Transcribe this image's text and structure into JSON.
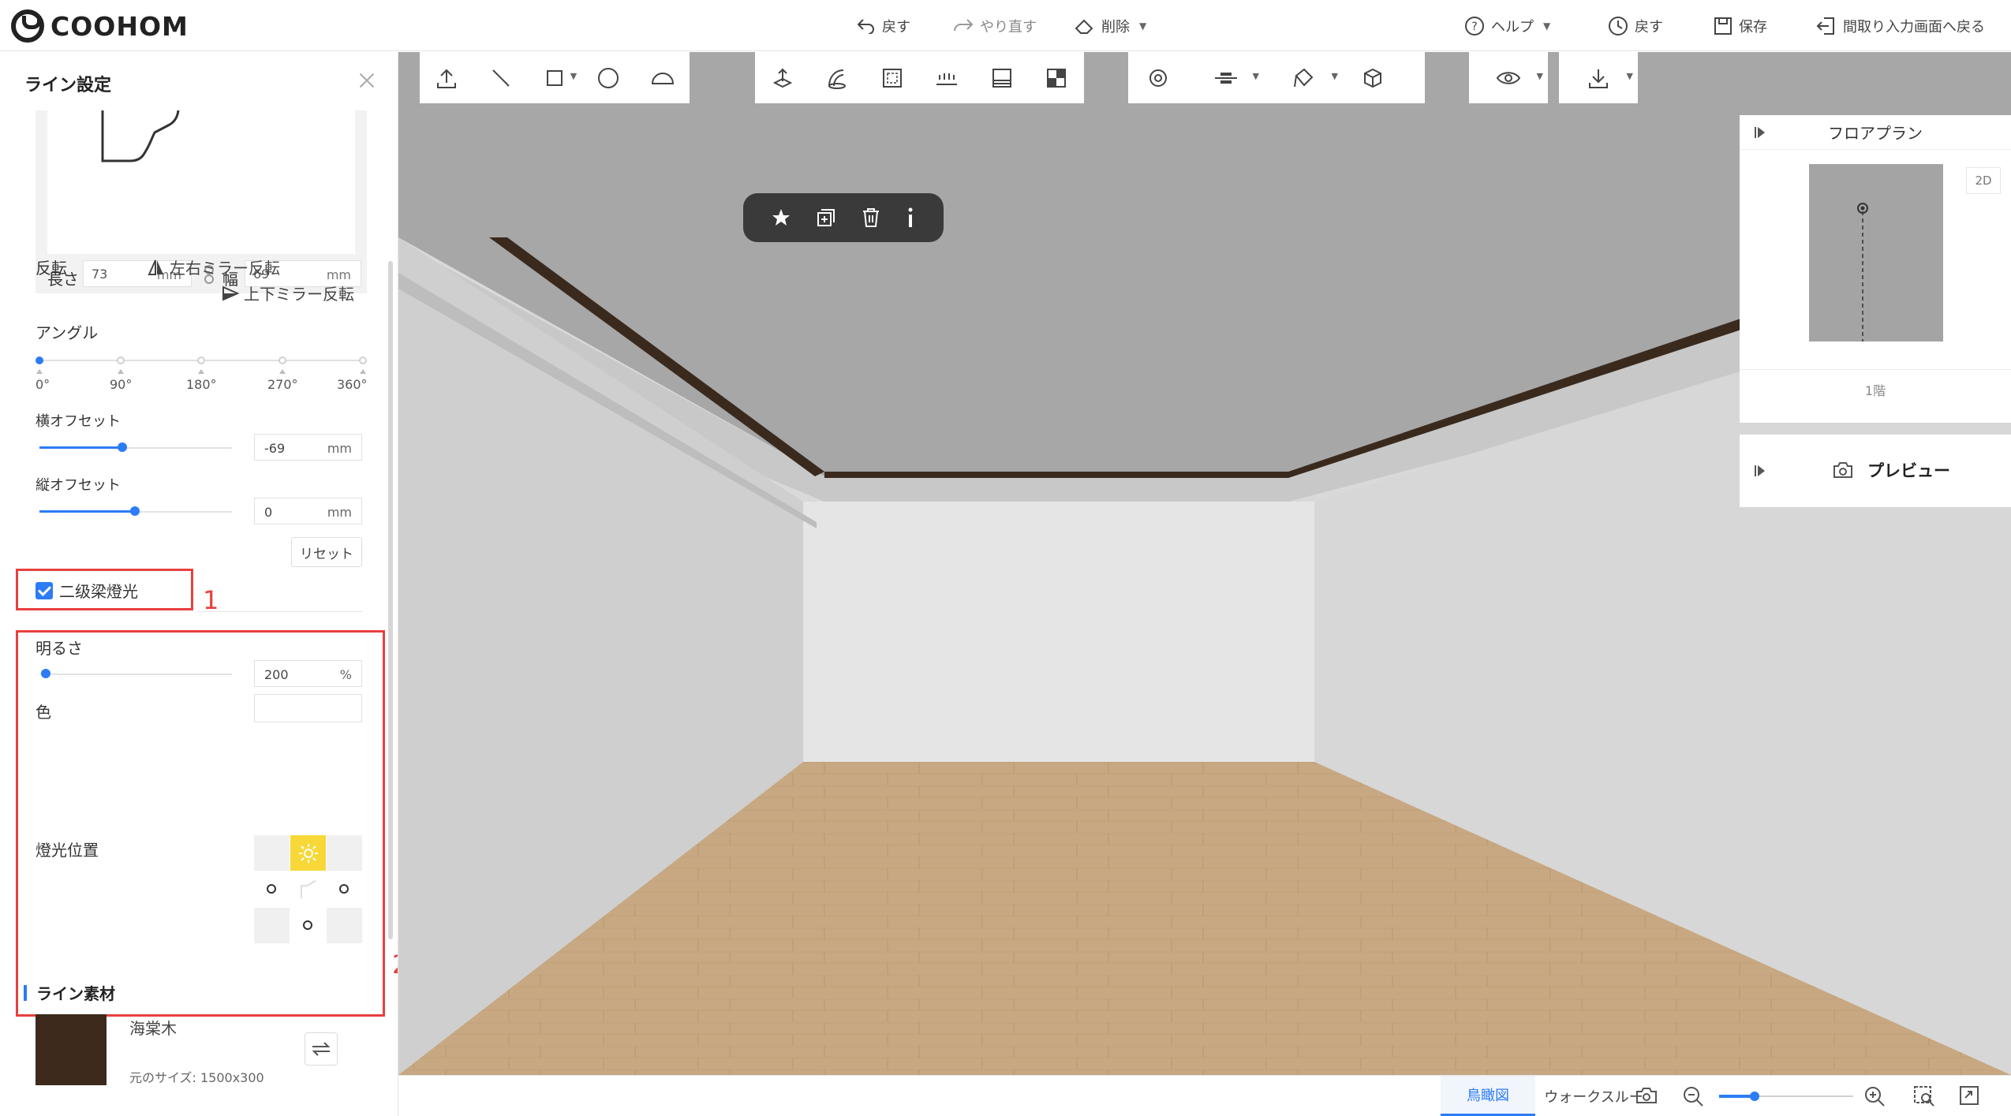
{
  "app": {
    "logo_text": "COOHOM"
  },
  "topbar": {
    "undo": "戻す",
    "redo": "やり直す",
    "delete": "削除",
    "help": "ヘルプ",
    "history": "戻す",
    "save": "保存",
    "back_to_floorplan": "間取り入力画面へ戻る"
  },
  "left_panel": {
    "title": "ライン設定",
    "length_label": "長さ",
    "length_value": "73",
    "width_label": "幅",
    "width_value": "69",
    "unit_mm": "mm",
    "flip_label": "反転",
    "mirror_lr": "左右ミラー反転",
    "mirror_ud": "上下ミラー反転",
    "angle_label": "アングル",
    "angle_stops": [
      "0°",
      "90°",
      "180°",
      "270°",
      "360°"
    ],
    "angle_value": "0°",
    "h_offset_label": "横オフセット",
    "h_offset_value": "-69",
    "v_offset_label": "縦オフセット",
    "v_offset_value": "0",
    "reset": "リセット",
    "beam_light_label": "二级梁燈光",
    "beam_light_checked": true,
    "brightness_label": "明るさ",
    "brightness_value": "200",
    "brightness_unit": "%",
    "color_label": "色",
    "light_position_label": "燈光位置",
    "annotation_1": "1",
    "annotation_2": "2",
    "material_section": "ライン素材",
    "material_name": "海棠木",
    "material_size": "元のサイズ: 1500x300",
    "material_color": "#3d2a1c"
  },
  "viewport": {
    "floorplan_title": "フロアプラン",
    "view_2d": "2D",
    "floor_label": "1階",
    "preview_label": "プレビュー"
  },
  "bottombar": {
    "tab_birdseye": "鳥瞰図",
    "tab_walkthrough": "ウォークスルー"
  },
  "colors": {
    "accent": "#2b7cf6",
    "annotation": "#e8403f",
    "light_active": "#f7d838"
  }
}
